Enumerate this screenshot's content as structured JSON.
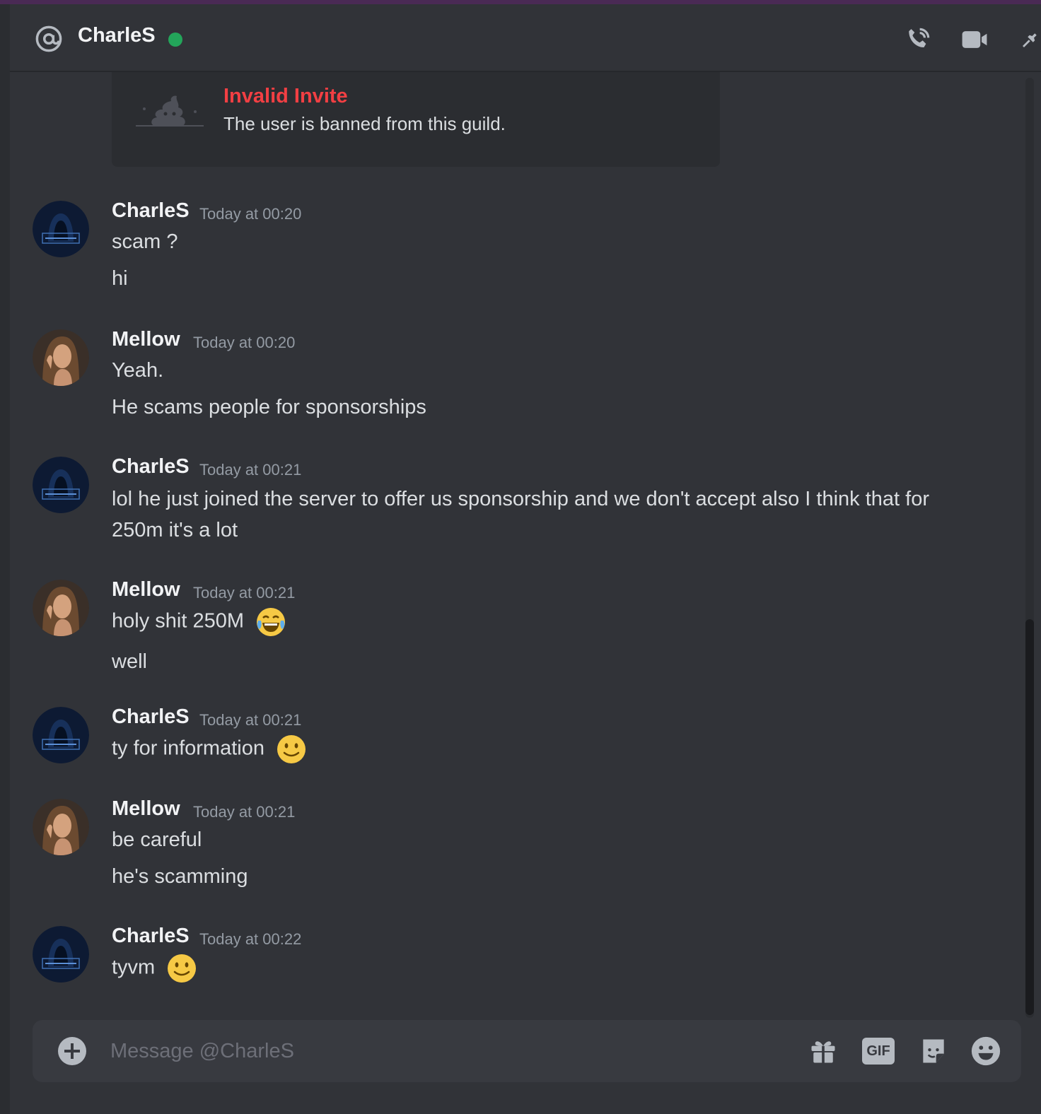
{
  "header": {
    "channel_name": "CharleS",
    "status": "online",
    "icons": [
      "at-icon",
      "voice-call-icon",
      "video-call-icon",
      "pin-icon"
    ]
  },
  "invite": {
    "title": "Invalid Invite",
    "description": "The user is banned from this guild."
  },
  "messages": [
    {
      "author": "CharleS",
      "timestamp": "Today at 00:20",
      "lines": [
        "scam ?",
        "hi"
      ]
    },
    {
      "author": "Mellow",
      "timestamp": "Today at 00:20",
      "lines": [
        "Yeah.",
        "He scams people for sponsorships"
      ]
    },
    {
      "author": "CharleS",
      "timestamp": "Today at 00:21",
      "lines": [
        "lol he just joined the server to offer us sponsorship and we don't accept also I think that for 250m it's a lot"
      ]
    },
    {
      "author": "Mellow",
      "timestamp": "Today at 00:21",
      "lines": [
        "holy shit 250M",
        "well"
      ],
      "emoji": "joy"
    },
    {
      "author": "CharleS",
      "timestamp": "Today at 00:21",
      "lines": [
        "ty for information"
      ],
      "emoji": "slightly-smiling"
    },
    {
      "author": "Mellow",
      "timestamp": "Today at 00:21",
      "lines": [
        "be careful",
        "he's scamming"
      ]
    },
    {
      "author": "CharleS",
      "timestamp": "Today at 00:22",
      "lines": [
        "tyvm"
      ],
      "emoji": "slightly-smiling"
    }
  ],
  "composer": {
    "placeholder": "Message @CharleS",
    "gif_label": "GIF"
  },
  "colors": {
    "background": "#313338",
    "online": "#23a55a",
    "error": "#f23f43"
  }
}
